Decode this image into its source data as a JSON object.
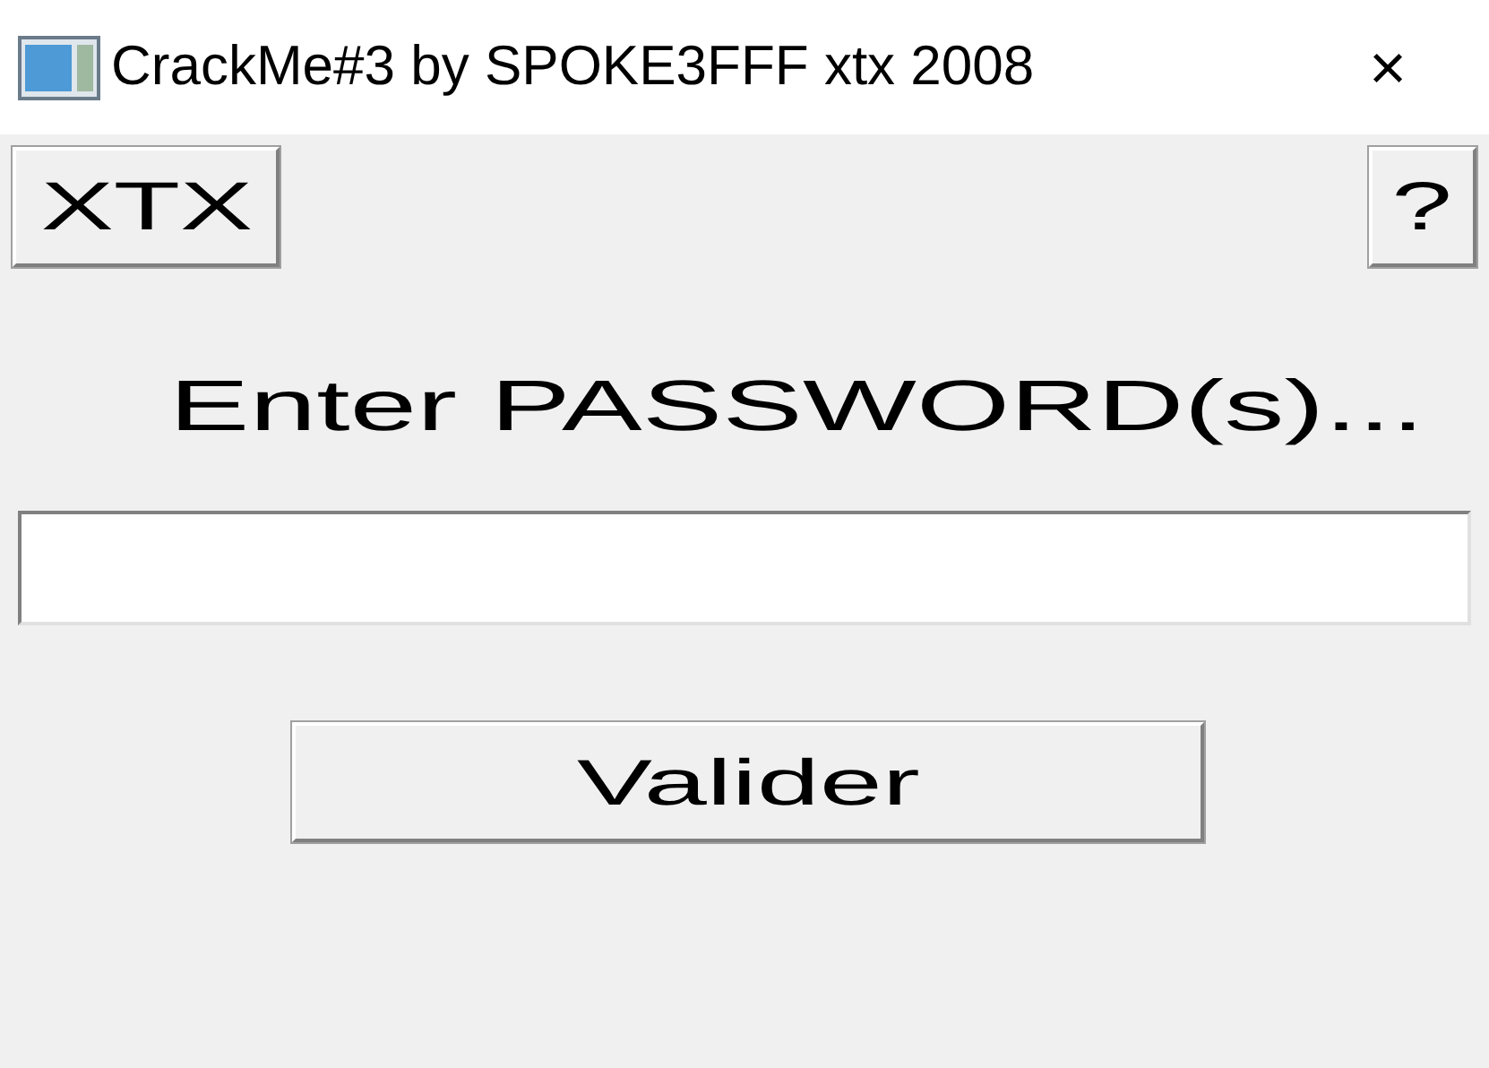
{
  "window": {
    "title": "CrackMe#3 by SPOKE3FFF xtx 2008",
    "close": "×"
  },
  "buttons": [
    "XTX",
    "?"
  ],
  "prompt": "Enter PASSWORD(s)...",
  "submit": "Valider"
}
